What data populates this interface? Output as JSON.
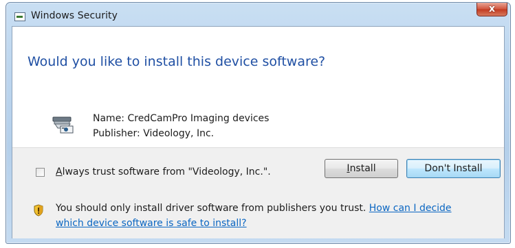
{
  "window": {
    "title": "Windows Security",
    "close_glyph": "x"
  },
  "dialog": {
    "heading": "Would you like to install this device software?",
    "name_line": "Name: CredCamPro Imaging devices",
    "publisher_line": "Publisher: Videology, Inc.",
    "device_icon": "device-driver-icon",
    "checkbox_label_accel": "A",
    "checkbox_label_rest": "lways trust software from \"Videology, Inc.\".",
    "checkbox_checked": false,
    "install_accel": "I",
    "install_rest": "nstall",
    "dont_install_label": "Don't Install",
    "warning_text": "You should only install driver software from publishers you trust.",
    "warning_link": "How can I decide which device software is safe to install?",
    "warning_icon": "shield-warning-icon"
  },
  "colors": {
    "heading": "#1f4fa3",
    "link": "#0a66c2",
    "close_button": "#c23a20"
  }
}
